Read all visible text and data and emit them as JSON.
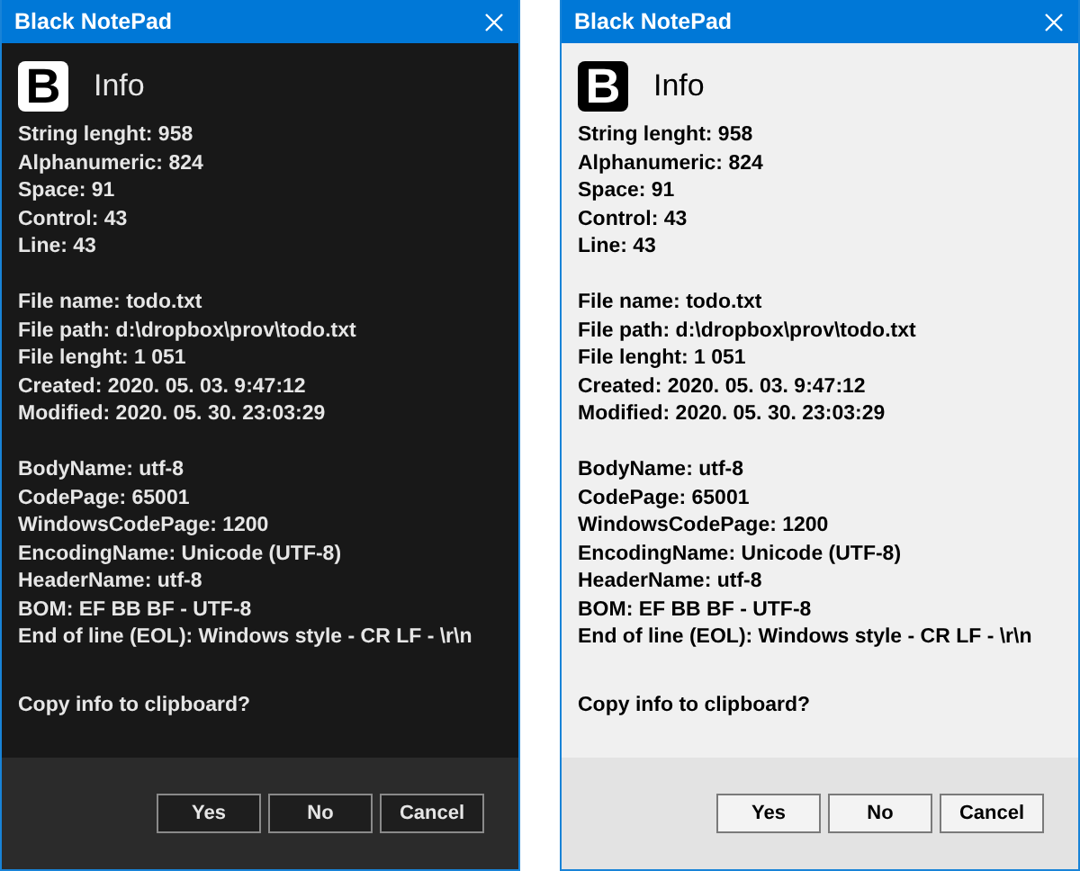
{
  "dialogs": [
    {
      "kind": "dark",
      "title": "Black NotePad",
      "logo_letter": "B",
      "heading": "Info",
      "groups": [
        [
          "String lenght: 958",
          "Alphanumeric: 824",
          "Space: 91",
          "Control: 43",
          "Line: 43"
        ],
        [
          "File name: todo.txt",
          "File path: d:\\dropbox\\prov\\todo.txt",
          "File lenght: 1 051",
          "Created: 2020. 05. 03. 9:47:12",
          "Modified: 2020. 05. 30. 23:03:29"
        ],
        [
          "BodyName: utf-8",
          "CodePage: 65001",
          "WindowsCodePage: 1200",
          "EncodingName: Unicode (UTF-8)",
          "HeaderName: utf-8",
          "BOM: EF BB BF - UTF-8",
          "End of line (EOL): Windows style - CR LF - \\r\\n"
        ]
      ],
      "question": "Copy info to clipboard?",
      "buttons": [
        "Yes",
        "No",
        "Cancel"
      ]
    },
    {
      "kind": "light",
      "title": "Black NotePad",
      "logo_letter": "B",
      "heading": "Info",
      "groups": [
        [
          "String lenght: 958",
          "Alphanumeric: 824",
          "Space: 91",
          "Control: 43",
          "Line: 43"
        ],
        [
          "File name: todo.txt",
          "File path: d:\\dropbox\\prov\\todo.txt",
          "File lenght: 1 051",
          "Created: 2020. 05. 03. 9:47:12",
          "Modified: 2020. 05. 30. 23:03:29"
        ],
        [
          "BodyName: utf-8",
          "CodePage: 65001",
          "WindowsCodePage: 1200",
          "EncodingName: Unicode (UTF-8)",
          "HeaderName: utf-8",
          "BOM: EF BB BF - UTF-8",
          "End of line (EOL): Windows style - CR LF - \\r\\n"
        ]
      ],
      "question": "Copy info to clipboard?",
      "buttons": [
        "Yes",
        "No",
        "Cancel"
      ]
    }
  ]
}
